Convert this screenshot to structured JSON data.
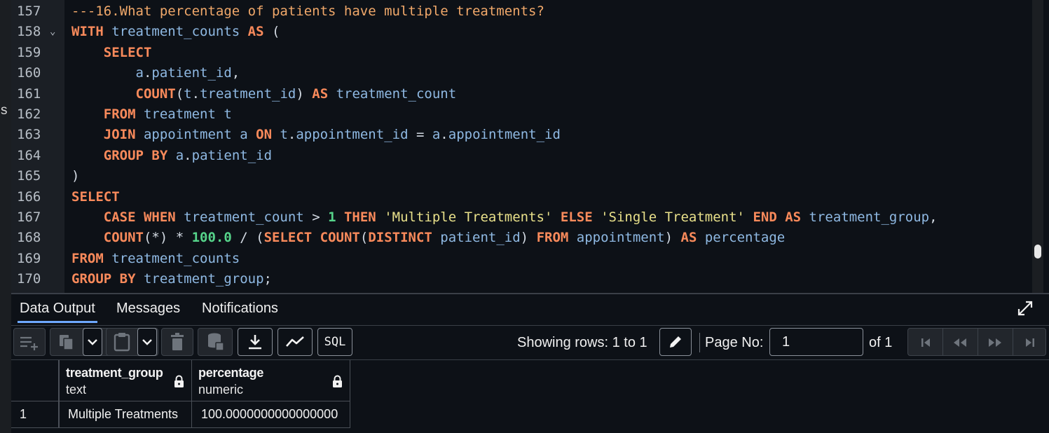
{
  "editor": {
    "edge_char": "s",
    "lines": [
      {
        "num": "157",
        "tokens": [
          {
            "t": "---16.What percentage of patients have multiple treatments?",
            "c": "c"
          }
        ]
      },
      {
        "num": "158",
        "fold": "⌄",
        "tokens": [
          {
            "t": "WITH",
            "c": "k"
          },
          {
            "t": " treatment_counts ",
            "c": "i"
          },
          {
            "t": "AS",
            "c": "k"
          },
          {
            "t": " (",
            "c": ""
          }
        ]
      },
      {
        "num": "159",
        "tokens": [
          {
            "t": "    ",
            "c": ""
          },
          {
            "t": "SELECT",
            "c": "k"
          }
        ]
      },
      {
        "num": "160",
        "tokens": [
          {
            "t": "        a",
            "c": "i"
          },
          {
            "t": ".",
            "c": ""
          },
          {
            "t": "patient_id",
            "c": "i"
          },
          {
            "t": ",",
            "c": ""
          }
        ]
      },
      {
        "num": "161",
        "tokens": [
          {
            "t": "        ",
            "c": ""
          },
          {
            "t": "COUNT",
            "c": "k"
          },
          {
            "t": "(",
            "c": ""
          },
          {
            "t": "t",
            "c": "i"
          },
          {
            "t": ".",
            "c": ""
          },
          {
            "t": "treatment_id",
            "c": "i"
          },
          {
            "t": ") ",
            "c": ""
          },
          {
            "t": "AS",
            "c": "k"
          },
          {
            "t": " treatment_count",
            "c": "i"
          }
        ]
      },
      {
        "num": "162",
        "tokens": [
          {
            "t": "    ",
            "c": ""
          },
          {
            "t": "FROM",
            "c": "k"
          },
          {
            "t": " treatment t",
            "c": "i"
          }
        ]
      },
      {
        "num": "163",
        "tokens": [
          {
            "t": "    ",
            "c": ""
          },
          {
            "t": "JOIN",
            "c": "k"
          },
          {
            "t": " appointment a ",
            "c": "i"
          },
          {
            "t": "ON",
            "c": "k"
          },
          {
            "t": " t",
            "c": "i"
          },
          {
            "t": ".",
            "c": ""
          },
          {
            "t": "appointment_id",
            "c": "i"
          },
          {
            "t": " = ",
            "c": ""
          },
          {
            "t": "a",
            "c": "i"
          },
          {
            "t": ".",
            "c": ""
          },
          {
            "t": "appointment_id",
            "c": "i"
          }
        ]
      },
      {
        "num": "164",
        "tokens": [
          {
            "t": "    ",
            "c": ""
          },
          {
            "t": "GROUP BY",
            "c": "k"
          },
          {
            "t": " a",
            "c": "i"
          },
          {
            "t": ".",
            "c": ""
          },
          {
            "t": "patient_id",
            "c": "i"
          }
        ]
      },
      {
        "num": "165",
        "tokens": [
          {
            "t": ")",
            "c": ""
          }
        ]
      },
      {
        "num": "166",
        "tokens": [
          {
            "t": "SELECT",
            "c": "k"
          }
        ]
      },
      {
        "num": "167",
        "tokens": [
          {
            "t": "    ",
            "c": ""
          },
          {
            "t": "CASE WHEN",
            "c": "k"
          },
          {
            "t": " treatment_count ",
            "c": "i"
          },
          {
            "t": "> ",
            "c": ""
          },
          {
            "t": "1",
            "c": "n"
          },
          {
            "t": " ",
            "c": ""
          },
          {
            "t": "THEN",
            "c": "k"
          },
          {
            "t": " ",
            "c": ""
          },
          {
            "t": "'Multiple Treatments'",
            "c": "s2"
          },
          {
            "t": " ",
            "c": ""
          },
          {
            "t": "ELSE",
            "c": "k"
          },
          {
            "t": " ",
            "c": ""
          },
          {
            "t": "'Single Treatment'",
            "c": "s2"
          },
          {
            "t": " ",
            "c": ""
          },
          {
            "t": "END AS",
            "c": "k"
          },
          {
            "t": " treatment_group",
            "c": "i"
          },
          {
            "t": ",",
            "c": ""
          }
        ]
      },
      {
        "num": "168",
        "tokens": [
          {
            "t": "    ",
            "c": ""
          },
          {
            "t": "COUNT",
            "c": "k"
          },
          {
            "t": "(*) * ",
            "c": ""
          },
          {
            "t": "100.0",
            "c": "n"
          },
          {
            "t": " / (",
            "c": ""
          },
          {
            "t": "SELECT COUNT",
            "c": "k"
          },
          {
            "t": "(",
            "c": ""
          },
          {
            "t": "DISTINCT",
            "c": "k"
          },
          {
            "t": " patient_id",
            "c": "i"
          },
          {
            "t": ") ",
            "c": ""
          },
          {
            "t": "FROM",
            "c": "k"
          },
          {
            "t": " appointment",
            "c": "i"
          },
          {
            "t": ") ",
            "c": ""
          },
          {
            "t": "AS",
            "c": "k"
          },
          {
            "t": " percentage",
            "c": "i"
          }
        ]
      },
      {
        "num": "169",
        "tokens": [
          {
            "t": "FROM",
            "c": "k"
          },
          {
            "t": " treatment_counts",
            "c": "i"
          }
        ]
      },
      {
        "num": "170",
        "tokens": [
          {
            "t": "GROUP BY",
            "c": "k"
          },
          {
            "t": " treatment_group",
            "c": "i"
          },
          {
            "t": ";",
            "c": ""
          }
        ]
      }
    ]
  },
  "tabs": [
    {
      "label": "Data Output",
      "active": true
    },
    {
      "label": "Messages",
      "active": false
    },
    {
      "label": "Notifications",
      "active": false
    }
  ],
  "toolbar": {
    "sql_label": "SQL",
    "rows_text": "Showing rows: 1 to 1",
    "page_label": "Page No:",
    "page_value": "1",
    "of_text": "of 1"
  },
  "grid": {
    "columns": [
      {
        "name": "treatment_group",
        "type": "text"
      },
      {
        "name": "percentage",
        "type": "numeric"
      }
    ],
    "rows": [
      {
        "num": "1",
        "cells": [
          "Multiple Treatments",
          "100.0000000000000000"
        ]
      }
    ]
  }
}
